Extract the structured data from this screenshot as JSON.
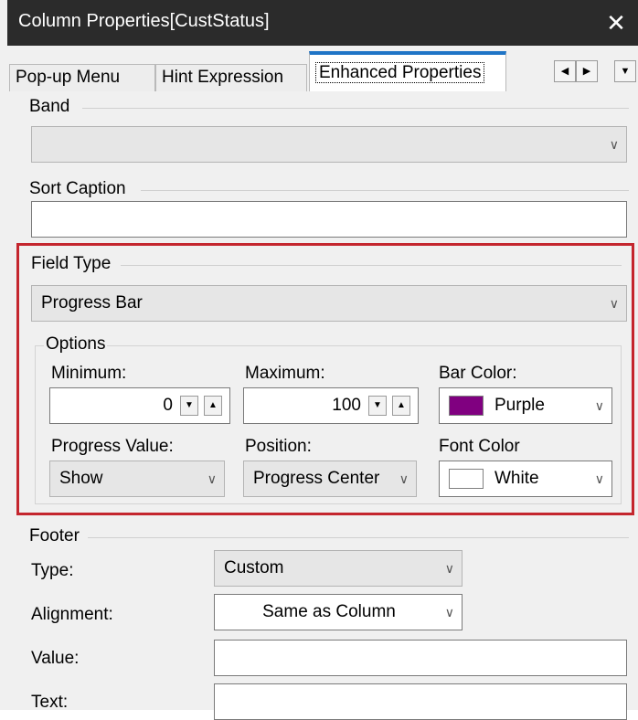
{
  "window": {
    "title": "Column Properties[CustStatus]",
    "close_glyph": "✕"
  },
  "tabs": [
    {
      "label": "Pop-up Menu",
      "active": false
    },
    {
      "label": "Hint Expression",
      "active": false
    },
    {
      "label": "Enhanced Properties",
      "active": true
    }
  ],
  "tab_scroll": {
    "left": "◀",
    "right": "▶",
    "menu": "▼"
  },
  "band": {
    "label": "Band",
    "value": ""
  },
  "sort_caption": {
    "label": "Sort Caption",
    "value": ""
  },
  "field_type": {
    "label": "Field Type",
    "value": "Progress Bar",
    "options": {
      "label": "Options",
      "minimum": {
        "label": "Minimum:",
        "value": "0"
      },
      "maximum": {
        "label": "Maximum:",
        "value": "100"
      },
      "bar_color": {
        "label": "Bar Color:",
        "value": "Purple",
        "swatch": "#800080"
      },
      "progress_value": {
        "label": "Progress Value:",
        "value": "Show"
      },
      "position": {
        "label": "Position:",
        "value": "Progress Center"
      },
      "font_color": {
        "label": "Font Color",
        "value": "White",
        "swatch": "#ffffff"
      }
    }
  },
  "footer": {
    "label": "Footer",
    "type": {
      "label": "Type:",
      "value": "Custom"
    },
    "alignment": {
      "label": "Alignment:",
      "value": "Same as Column"
    },
    "value": {
      "label": "Value:",
      "value": ""
    },
    "text": {
      "label": "Text:",
      "value": ""
    }
  },
  "icons": {
    "chevron": "∨",
    "spin_down": "▼",
    "spin_up": "▲"
  },
  "colors": {
    "highlight": "#c4262e",
    "active_tab": "#1e74c6",
    "titlebar": "#2b2b2b"
  }
}
